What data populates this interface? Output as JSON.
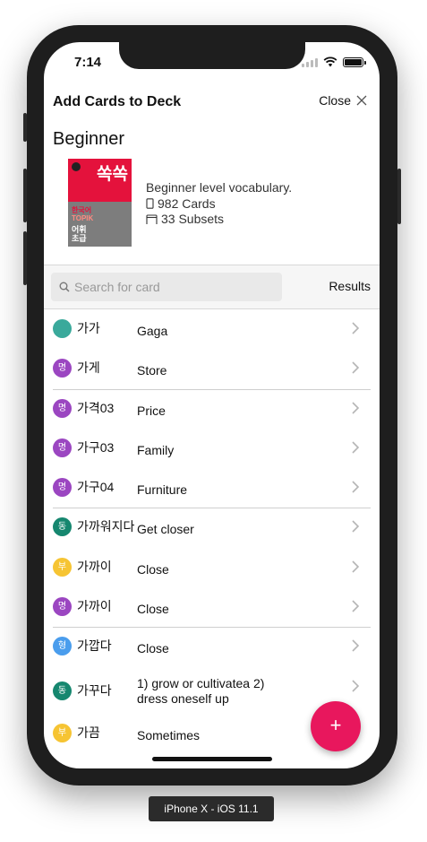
{
  "status": {
    "time": "7:14"
  },
  "header": {
    "title": "Add Cards to Deck",
    "close_label": "Close"
  },
  "deck": {
    "name": "Beginner",
    "cover_title": "쏙쏙",
    "cover_line1": "한국어",
    "cover_line2": "TOPIK",
    "cover_line3": "어휘",
    "cover_line4": "초급",
    "description": "Beginner level vocabulary.",
    "cards": "982 Cards",
    "subsets": "33 Subsets"
  },
  "search": {
    "placeholder": "Search for card",
    "value": "",
    "results_label": "Results"
  },
  "list": [
    {
      "badge": "",
      "word": "가가",
      "meaning": "Gaga",
      "color": "#3aa99b"
    },
    {
      "badge": "명",
      "word": "가게",
      "meaning": "Store",
      "color": "#9b46c1"
    },
    {
      "badge": "명",
      "word": "가격03",
      "meaning": "Price",
      "color": "#9b46c1"
    },
    {
      "badge": "명",
      "word": "가구03",
      "meaning": "Family",
      "color": "#9b46c1"
    },
    {
      "badge": "명",
      "word": "가구04",
      "meaning": "Furniture",
      "color": "#9b46c1"
    },
    {
      "badge": "동",
      "word": "가까워지다",
      "meaning": "Get closer",
      "color": "#16876f"
    },
    {
      "badge": "부",
      "word": "가까이",
      "meaning": "Close",
      "color": "#f6c433"
    },
    {
      "badge": "명",
      "word": "가까이",
      "meaning": "Close",
      "color": "#9b46c1"
    },
    {
      "badge": "형",
      "word": "가깝다",
      "meaning": "Close",
      "color": "#4a9ded"
    },
    {
      "badge": "동",
      "word": "가꾸다",
      "meaning": "1) grow or cultivatea 2) dress oneself up",
      "color": "#16876f"
    },
    {
      "badge": "부",
      "word": "가끔",
      "meaning": "Sometimes",
      "color": "#f6c433"
    }
  ],
  "fab": {
    "label": "+"
  },
  "device_label": "iPhone X - iOS 11.1",
  "colors": {
    "accent": "#e8175d",
    "cover_red": "#e4123c"
  },
  "icons": [
    "search-icon",
    "close-icon",
    "chevron-right-icon",
    "card-icon",
    "folder-icon",
    "wifi-icon",
    "battery-icon",
    "signal-icon"
  ]
}
